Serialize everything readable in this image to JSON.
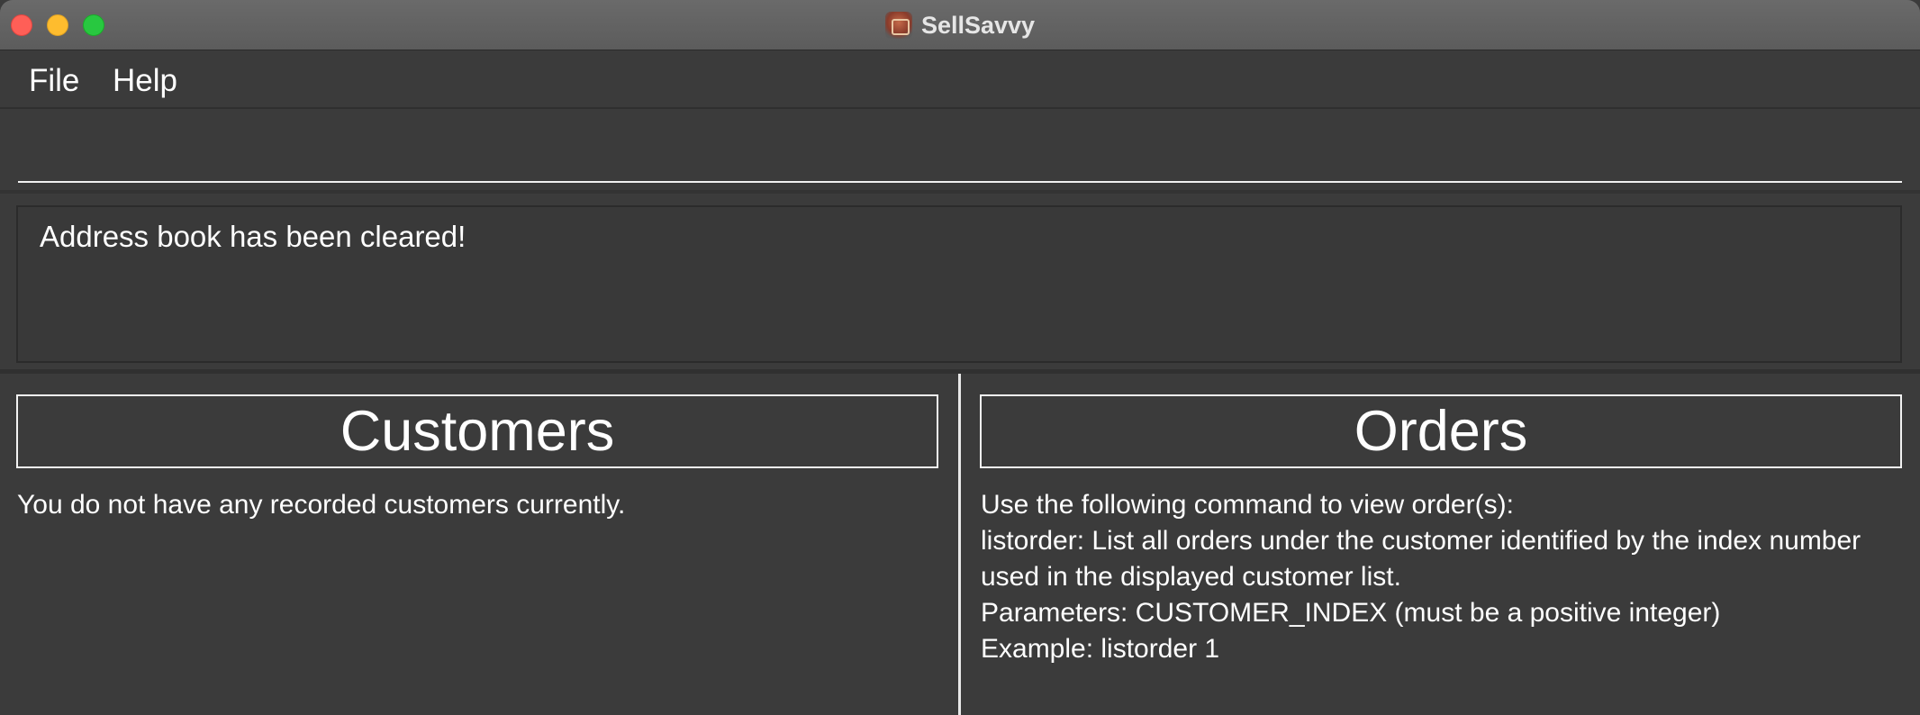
{
  "window": {
    "title": "SellSavvy",
    "icon": "sellsavvy-app-icon"
  },
  "menu": {
    "items": [
      {
        "label": "File"
      },
      {
        "label": "Help"
      }
    ]
  },
  "command": {
    "value": "",
    "placeholder": ""
  },
  "result": {
    "message": "Address book has been cleared!"
  },
  "customers": {
    "header": "Customers",
    "empty_message": "You do not have any recorded customers currently."
  },
  "orders": {
    "header": "Orders",
    "help_lines": [
      "Use the following command to view order(s):",
      "listorder: List all orders under the customer identified by the index number",
      "used in the displayed customer list.",
      "Parameters: CUSTOMER_INDEX (must be a positive integer)",
      "Example: listorder 1"
    ]
  },
  "colors": {
    "background": "#3b3b3b",
    "titlebar": "#636363",
    "traffic_close": "#ff5f57",
    "traffic_minimize": "#febc2e",
    "traffic_zoom": "#28c840",
    "text": "#ffffff"
  }
}
